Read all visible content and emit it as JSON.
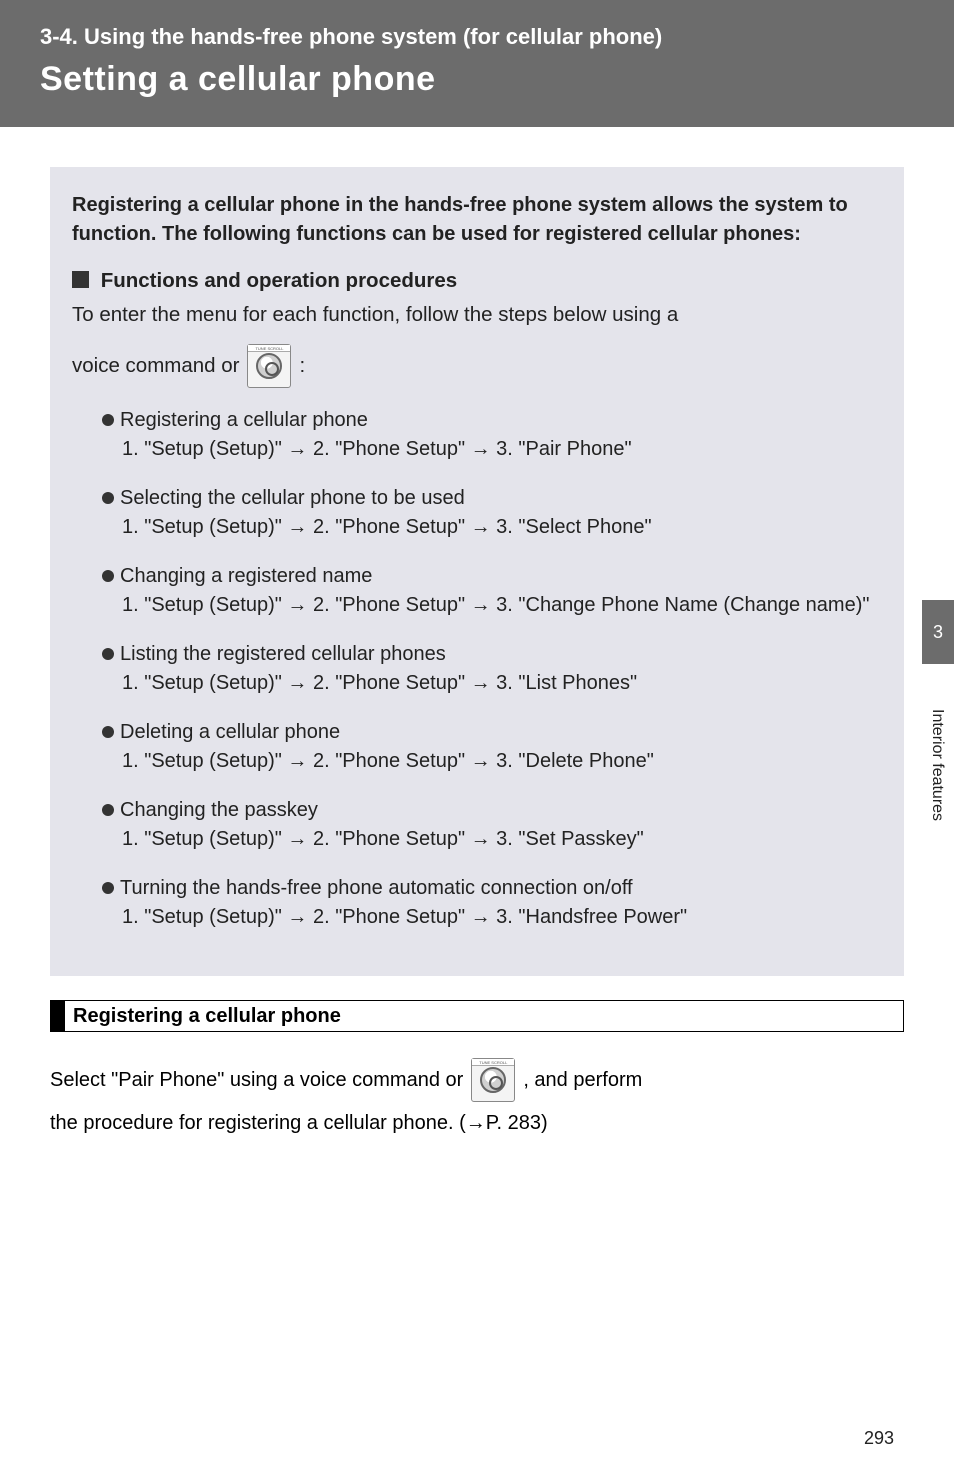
{
  "header": {
    "super": "3-4. Using the hands-free phone system (for cellular phone)",
    "title": "Setting a cellular phone"
  },
  "intro": "Registering a cellular phone in the hands-free phone system allows the system to function. The following functions can be used for registered cellular phones:",
  "section": {
    "head": "Functions and operation procedures",
    "lead": "To enter the menu for each function, follow the steps below using a",
    "lead2_before": "voice command or",
    "lead2_after": ":"
  },
  "items": [
    {
      "title": "Registering a cellular phone",
      "body": "1. \"Setup (Setup)\" → 2. \"Phone Setup\" → 3. \"Pair Phone\""
    },
    {
      "title": "Selecting the cellular phone to be used",
      "body": "1. \"Setup (Setup)\" → 2. \"Phone Setup\" → 3. \"Select Phone\""
    },
    {
      "title": "Changing a registered name",
      "body": "1. \"Setup (Setup)\" → 2. \"Phone Setup\" → 3. \"Change Phone Name (Change name)\""
    },
    {
      "title": "Listing the registered cellular phones",
      "body": "1. \"Setup (Setup)\" → 2. \"Phone Setup\" → 3. \"List Phones\""
    },
    {
      "title": "Deleting a cellular phone",
      "body": "1. \"Setup (Setup)\" → 2. \"Phone Setup\" → 3. \"Delete Phone\""
    },
    {
      "title": "Changing the passkey",
      "body": "1. \"Setup (Setup)\" → 2. \"Phone Setup\" → 3. \"Set Passkey\""
    },
    {
      "title": "Turning the hands-free phone automatic connection on/off",
      "body": "1. \"Setup (Setup)\" → 2. \"Phone Setup\" → 3. \"Handsfree Power\""
    }
  ],
  "registering": {
    "title": "Registering a cellular phone",
    "line1_before": "Select \"Pair Phone\" using a voice command or",
    "line1_after": ", and perform",
    "line2": "the procedure for registering a cellular phone. (→P. 283)"
  },
  "side": {
    "tab": "3",
    "label": "Interior features"
  },
  "page_number": "293"
}
